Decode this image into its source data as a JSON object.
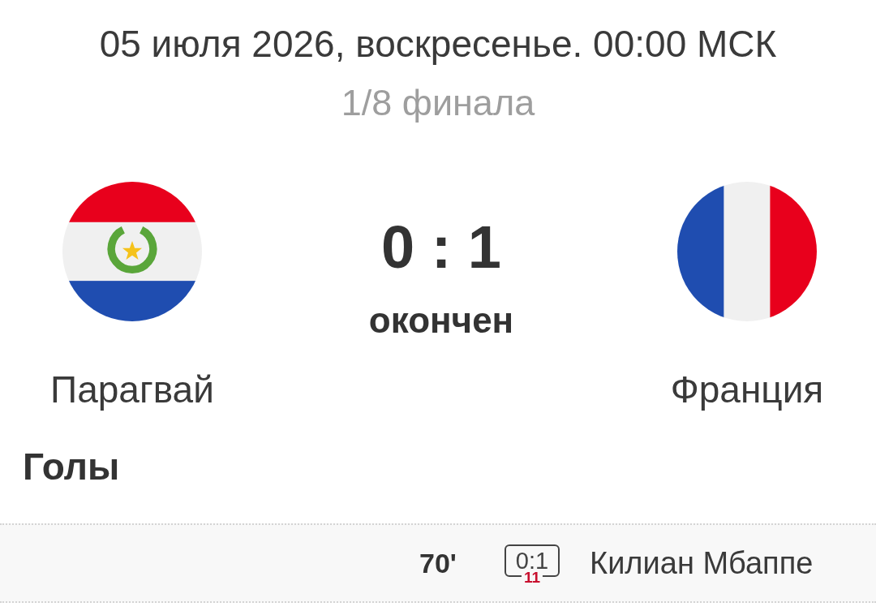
{
  "header": {
    "date": "05 июля 2026, воскресенье. 00:00 МСК",
    "stage": "1/8 финала"
  },
  "match": {
    "home": {
      "name": "Парагвай"
    },
    "score": "0 : 1",
    "status": "окончен",
    "away": {
      "name": "Франция"
    }
  },
  "goals": {
    "title": "Голы",
    "items": [
      {
        "kind": "away",
        "minute": "70'",
        "score": "0:1",
        "number": "11",
        "player": "Килиан Мбаппе"
      }
    ]
  }
}
